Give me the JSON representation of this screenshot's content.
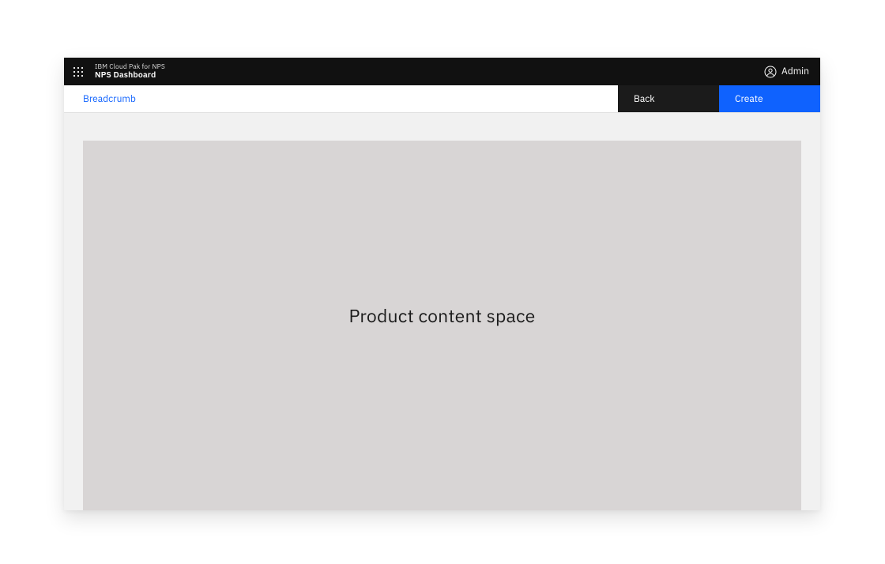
{
  "header": {
    "suite": "IBM Cloud Pak for NPS",
    "product": "NPS Dashboard",
    "user_label": "Admin"
  },
  "actionbar": {
    "breadcrumb": "Breadcrumb",
    "back_label": "Back",
    "create_label": "Create"
  },
  "main": {
    "placeholder_text": "Product content space"
  },
  "colors": {
    "primary": "#0f62fe",
    "topbar_bg": "#111111",
    "back_btn_bg": "#1b1b1b",
    "canvas_bg": "#f1f1f1",
    "placeholder_bg": "#d8d5d5"
  }
}
